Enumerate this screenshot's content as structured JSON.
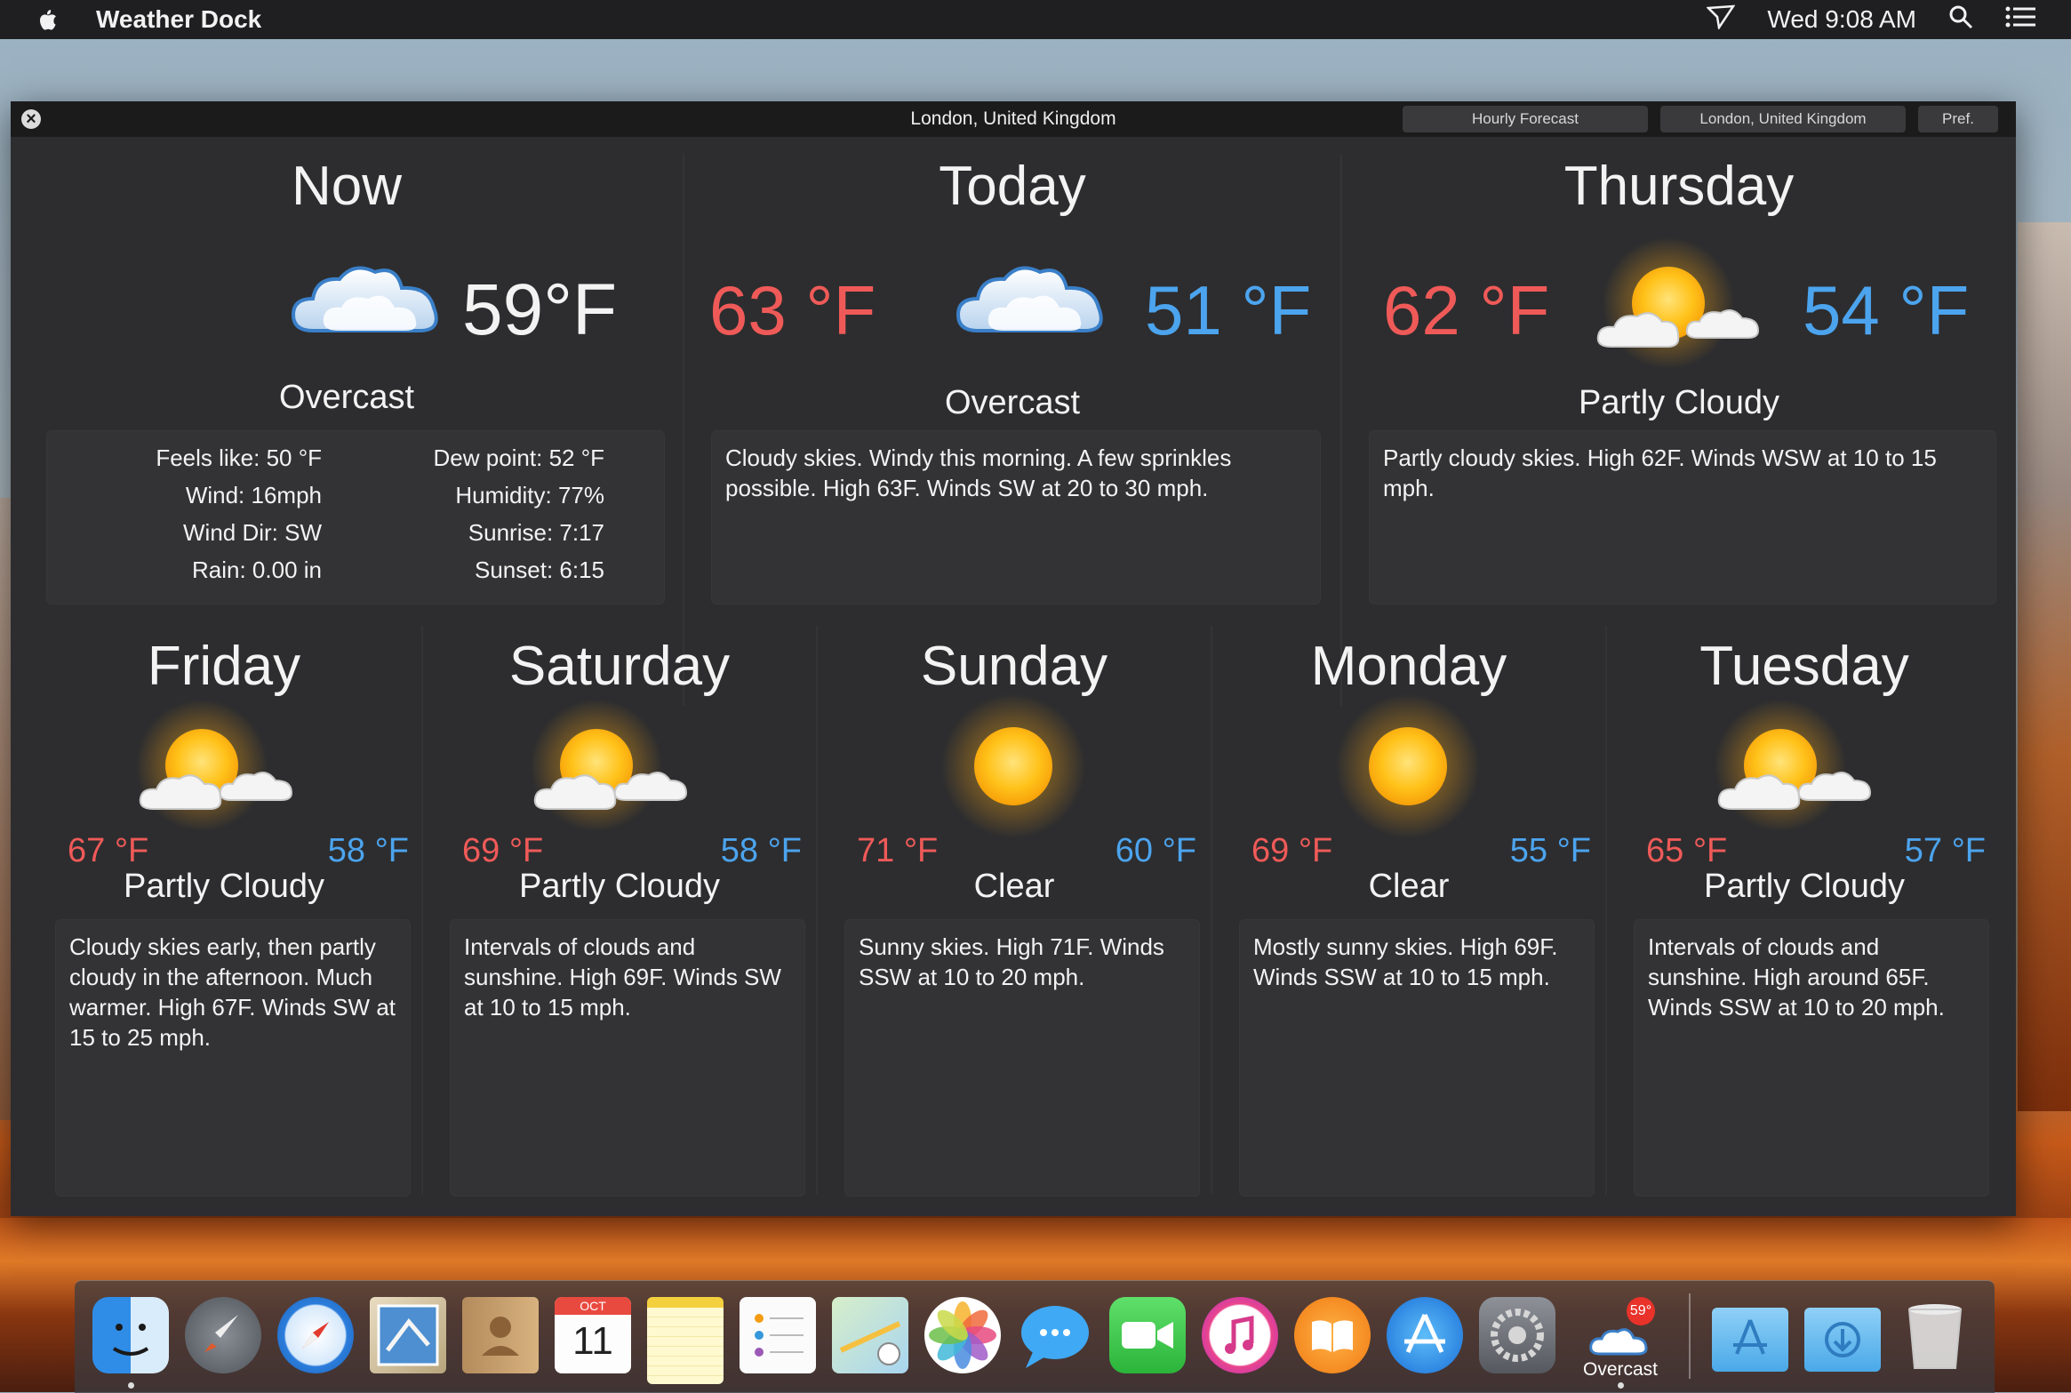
{
  "menubar": {
    "app_name": "Weather Dock",
    "clock": "Wed 9:08 AM"
  },
  "window": {
    "title": "London, United Kingdom",
    "buttons": {
      "hourly": "Hourly Forecast",
      "location": "London, United Kingdom",
      "pref": "Pref."
    }
  },
  "now": {
    "heading": "Now",
    "temp": "59°F",
    "condition": "Overcast",
    "icon": "overcast-icon",
    "details_left": [
      "Feels like: 50 °F",
      "Wind: 16mph",
      "Wind Dir: SW",
      "Rain: 0.00 in"
    ],
    "details_right": [
      "Dew point: 52 °F",
      "Humidity: 77%",
      "Sunrise: 7:17",
      "Sunset: 6:15"
    ]
  },
  "today": {
    "heading": "Today",
    "high": "63 °F",
    "low": "51 °F",
    "condition": "Overcast",
    "icon": "overcast-icon",
    "description": "Cloudy skies. Windy this morning. A few sprinkles possible. High 63F. Winds SW at 20 to 30 mph."
  },
  "thursday": {
    "heading": "Thursday",
    "high": "62 °F",
    "low": "54 °F",
    "condition": "Partly Cloudy",
    "icon": "partly-cloudy-icon",
    "description": "Partly cloudy skies. High 62F. Winds WSW at 10 to 15 mph."
  },
  "days": [
    {
      "heading": "Friday",
      "high": "67 °F",
      "low": "58 °F",
      "condition": "Partly Cloudy",
      "icon": "partly-cloudy-icon",
      "description": "Cloudy skies early, then partly cloudy in the afternoon. Much warmer. High 67F. Winds SW at 15 to 25 mph."
    },
    {
      "heading": "Saturday",
      "high": "69 °F",
      "low": "58 °F",
      "condition": "Partly Cloudy",
      "icon": "partly-cloudy-icon",
      "description": "Intervals of clouds and sunshine. High 69F. Winds SW at 10 to 15 mph."
    },
    {
      "heading": "Sunday",
      "high": "71 °F",
      "low": "60 °F",
      "condition": "Clear",
      "icon": "sun-icon",
      "description": "Sunny skies. High 71F. Winds SSW at 10 to 20 mph."
    },
    {
      "heading": "Monday",
      "high": "69 °F",
      "low": "55 °F",
      "condition": "Clear",
      "icon": "sun-icon",
      "description": "Mostly sunny skies. High 69F. Winds SSW at 10 to 15 mph."
    },
    {
      "heading": "Tuesday",
      "high": "65 °F",
      "low": "57 °F",
      "condition": "Partly Cloudy",
      "icon": "partly-cloudy-icon",
      "description": "Intervals of clouds and sunshine. High around 65F. Winds SSW at 10 to 20 mph."
    }
  ],
  "dock": {
    "calendar_month": "OCT",
    "calendar_day": "11",
    "weather_badge": "59°",
    "weather_label": "Overcast"
  },
  "colors": {
    "high": "#ef5a58",
    "low": "#4ca4ee",
    "window_bg": "#2d2d2f"
  }
}
